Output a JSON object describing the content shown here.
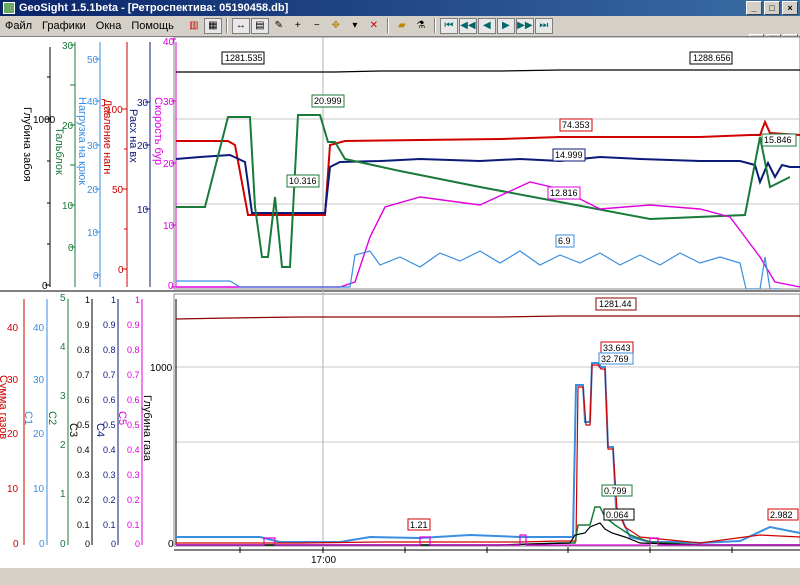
{
  "window": {
    "title": "GeoSight 1.5.1beta  - [Ретроспектива: 05190458.db]"
  },
  "menu": {
    "items": [
      "Файл",
      "Графики",
      "Окна",
      "Помощь"
    ]
  },
  "toolbar": {
    "icons": [
      "bar-chart",
      "grid",
      "cursor",
      "layout",
      "wrench",
      "plus",
      "minus",
      "move",
      "arrow-down",
      "delete",
      "folder",
      "filter",
      "first",
      "prev-page",
      "prev",
      "next",
      "next-page",
      "last"
    ]
  },
  "colors": {
    "titlebar": "#0a246a",
    "red": "#d00000",
    "navy": "#0a1a7a",
    "green": "#1a7a3a",
    "magenta": "#e000e0",
    "lightblue": "#3a8ee0",
    "black": "#000000"
  },
  "top_panel": {
    "axes": [
      {
        "label": "Глубина забоя",
        "ticks": [
          "1000",
          "0"
        ],
        "color": "#000000"
      },
      {
        "label": "Тальблок",
        "ticks": [
          "30",
          "20",
          "10",
          "0"
        ],
        "color": "#1a7a3a"
      },
      {
        "label": "Нагрузка на крюк",
        "ticks": [
          "50",
          "40",
          "30",
          "20",
          "10",
          "0"
        ],
        "color": "#3a8ee0"
      },
      {
        "label": "Давление нагн",
        "ticks": [
          "100",
          "50",
          "0"
        ],
        "color": "#d00000"
      },
      {
        "label": "Расх на вх",
        "ticks": [
          "30",
          "20",
          "10"
        ],
        "color": "#0a1a7a"
      },
      {
        "label": "Скорость бур",
        "ticks": [
          "40",
          "30",
          "20",
          "10",
          "0"
        ],
        "color": "#e000e0"
      }
    ],
    "labels": [
      "1281.535",
      "1288.656",
      "20.999",
      "74.353",
      "14.999",
      "15.846",
      "10.316",
      "12.816",
      "6.9"
    ]
  },
  "bottom_panel": {
    "axes": [
      {
        "label": "Сумма газов",
        "ticks": [
          "40",
          "30",
          "20",
          "10",
          "0"
        ],
        "color": "#d00000"
      },
      {
        "label": "С1",
        "ticks": [
          "40",
          "30",
          "20",
          "10",
          "0"
        ],
        "color": "#3a8ee0"
      },
      {
        "label": "С2",
        "ticks": [
          "5",
          "4",
          "3",
          "2",
          "1",
          "0"
        ],
        "color": "#1a7a3a"
      },
      {
        "label": "С3",
        "ticks": [
          "1",
          "0.9",
          "0.8",
          "0.7",
          "0.6",
          "0.5",
          "0.4",
          "0.3",
          "0.2",
          "0.1",
          "0"
        ],
        "color": "#000000"
      },
      {
        "label": "С4",
        "ticks": [
          "1",
          "0.9",
          "0.8",
          "0.7",
          "0.6",
          "0.5",
          "0.4",
          "0.3",
          "0.2",
          "0.1",
          "0"
        ],
        "color": "#0a1a7a"
      },
      {
        "label": "С5",
        "ticks": [
          "1",
          "0.9",
          "0.8",
          "0.7",
          "0.6",
          "0.5",
          "0.4",
          "0.3",
          "0.2",
          "0.1",
          "0"
        ],
        "color": "#e000e0"
      },
      {
        "label": "Глубина газа",
        "ticks": [
          "1000",
          "0"
        ],
        "color": "#000000"
      }
    ],
    "labels": [
      "1281.44",
      "33.643",
      "32.769",
      "0.799",
      "0.064",
      "1.21",
      "2.982"
    ]
  },
  "time_axis": {
    "label": "17:00"
  }
}
